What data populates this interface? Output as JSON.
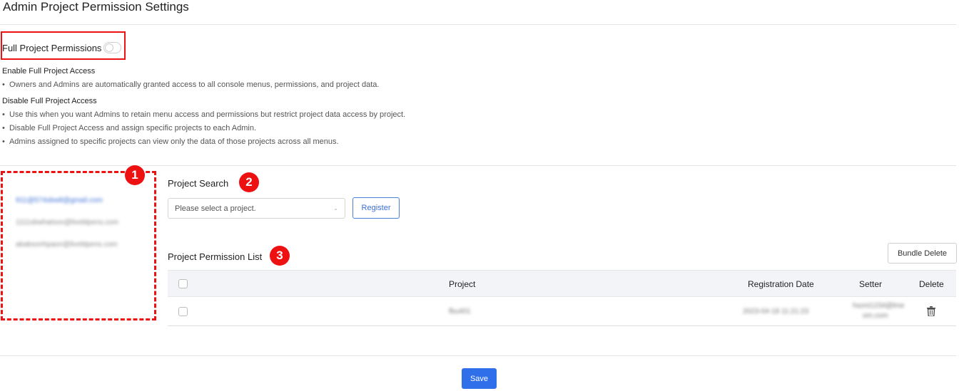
{
  "page": {
    "title": "Admin Project Permission Settings"
  },
  "full_permissions": {
    "label": "Full Project Permissions",
    "enabled": false,
    "enable_heading": "Enable Full Project Access",
    "enable_bullets": [
      "Owners and Admins are automatically granted access to all console menus, permissions, and project data."
    ],
    "disable_heading": "Disable Full Project Access",
    "disable_bullets": [
      "Use this when you want Admins to retain menu access and permissions but restrict project data access by project.",
      "Disable Full Project Access and assign specific projects to each Admin.",
      "Admins assigned to specific projects can view only the data of those projects across all menus."
    ]
  },
  "badges": [
    "1",
    "2",
    "3"
  ],
  "admin_list": {
    "items": [
      {
        "label": "911@574sbw8@gmail.com",
        "active": true
      },
      {
        "label": "1111sbwhatson@liveblpens.com",
        "active": false
      },
      {
        "label": "ababsonhpaon@liveblpens.com",
        "active": false
      }
    ]
  },
  "project_search": {
    "title": "Project Search",
    "placeholder": "Please select a project.",
    "register_label": "Register"
  },
  "permission_list": {
    "title": "Project Permission List",
    "bundle_delete_label": "Bundle Delete",
    "columns": {
      "project": "Project",
      "registration_date": "Registration Date",
      "setter": "Setter",
      "delete": "Delete"
    },
    "rows": [
      {
        "project": "fbu401",
        "registration_date": "2023-04-18 11:21:23",
        "setter_line1": "hsoni1234@lme",
        "setter_line2": "om.com"
      }
    ]
  },
  "footer": {
    "save_label": "Save"
  },
  "colors": {
    "primary": "#2f6fea",
    "highlight": "#e11111",
    "link": "#3b6fd6"
  }
}
